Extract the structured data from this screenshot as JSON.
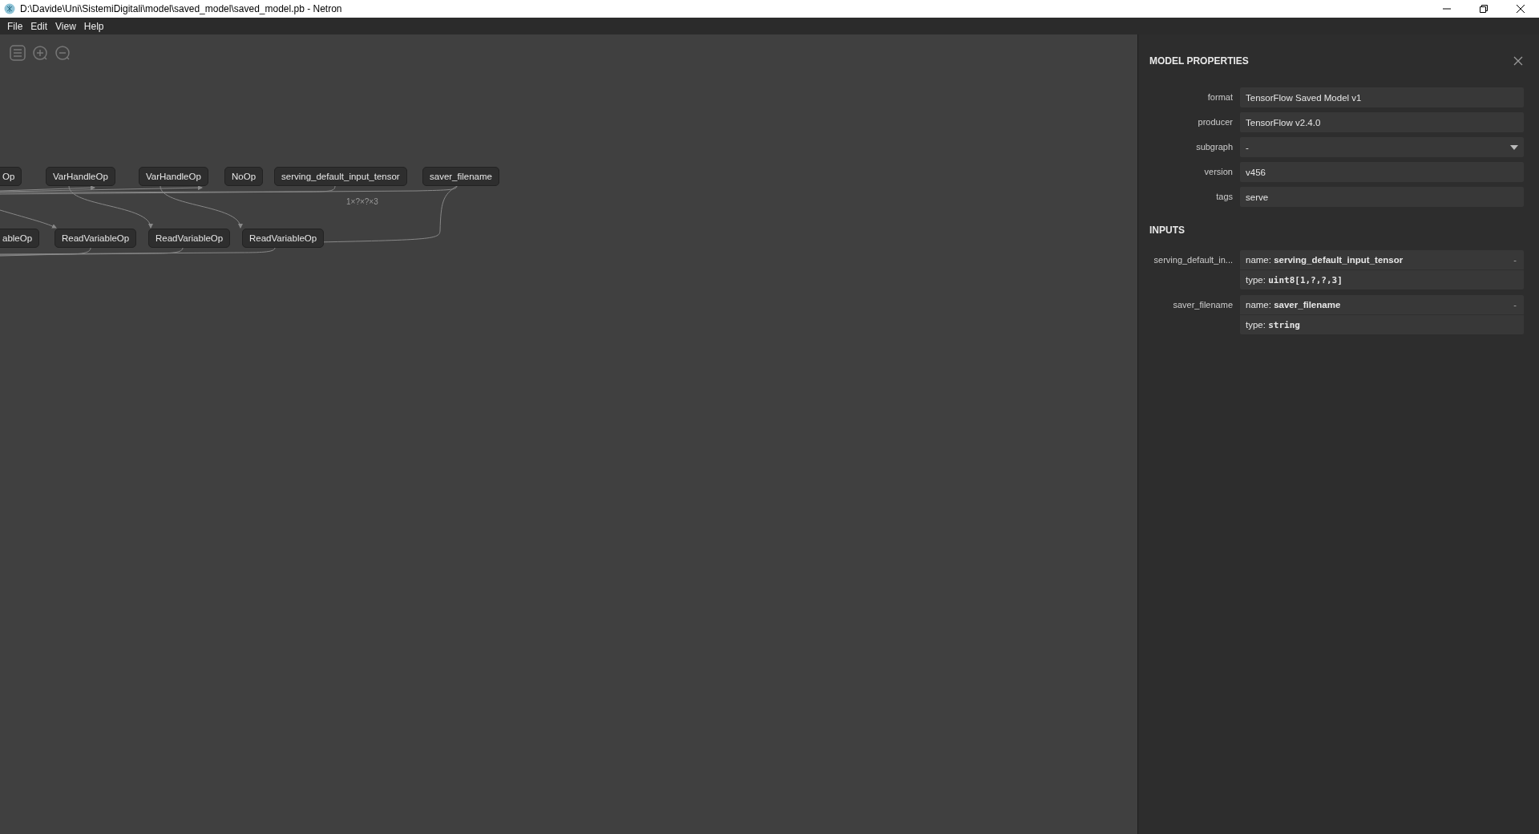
{
  "window": {
    "title": "D:\\Davide\\Uni\\SistemiDigitali\\model\\saved_model\\saved_model.pb - Netron"
  },
  "menu": [
    {
      "label": "File"
    },
    {
      "label": "Edit"
    },
    {
      "label": "View"
    },
    {
      "label": "Help"
    }
  ],
  "graph": {
    "top_nodes": [
      {
        "label": "Op"
      },
      {
        "label": "VarHandleOp"
      },
      {
        "label": "VarHandleOp"
      },
      {
        "label": "NoOp"
      },
      {
        "label": "serving_default_input_tensor"
      },
      {
        "label": "saver_filename"
      }
    ],
    "bottom_nodes": [
      {
        "label": "ableOp"
      },
      {
        "label": "ReadVariableOp"
      },
      {
        "label": "ReadVariableOp"
      },
      {
        "label": "ReadVariableOp"
      }
    ],
    "edge_labels": [
      "1×?×?×3"
    ]
  },
  "properties": {
    "title": "MODEL PROPERTIES",
    "fields": [
      {
        "label": "format",
        "value": "TensorFlow Saved Model v1",
        "kind": "text"
      },
      {
        "label": "producer",
        "value": "TensorFlow v2.4.0",
        "kind": "text"
      },
      {
        "label": "subgraph",
        "value": "-",
        "kind": "select"
      },
      {
        "label": "version",
        "value": "v456",
        "kind": "text"
      },
      {
        "label": "tags",
        "value": "serve",
        "kind": "text"
      }
    ],
    "inputs_heading": "INPUTS",
    "inputs": [
      {
        "label": "serving_default_in...",
        "name_prefix": "name:",
        "name": "serving_default_input_tensor",
        "toggle": "-",
        "type_prefix": "type:",
        "type": "uint8[1,?,?,3]"
      },
      {
        "label": "saver_filename",
        "name_prefix": "name:",
        "name": "saver_filename",
        "toggle": "-",
        "type_prefix": "type:",
        "type": "string"
      }
    ]
  }
}
